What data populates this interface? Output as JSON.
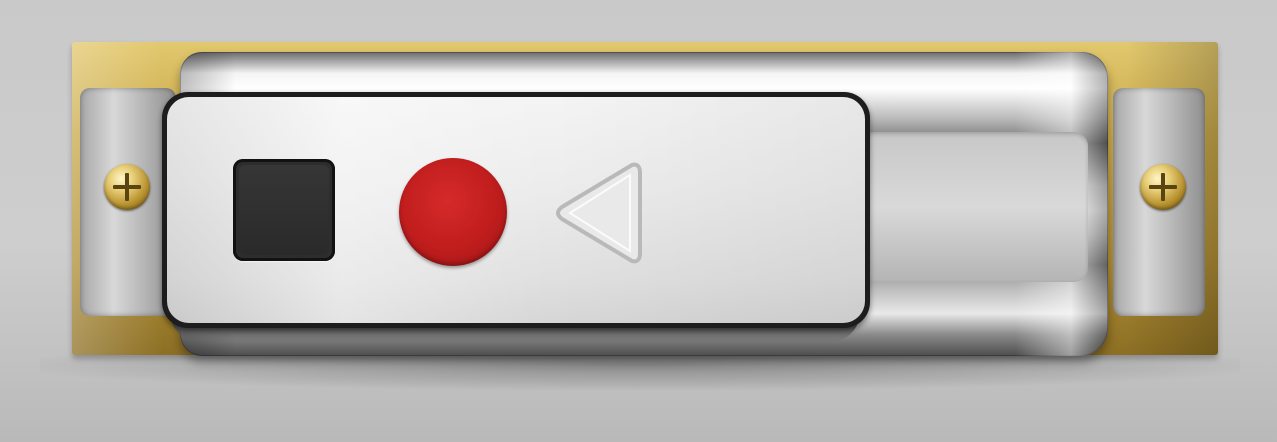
{
  "scene": {
    "subject": "",
    "colors": {
      "background": "#c9c9c9",
      "brass": "#c9a94b",
      "chrome": "#bdbdbd",
      "handle_face": "#ececec",
      "handle_border": "#1d1d1d",
      "red_button": "#c01d1d",
      "black_button": "#2d2d2d"
    }
  },
  "icons": {
    "square": "stop-square-icon",
    "circle": "record-circle-icon",
    "triangle": "play-back-triangle-icon",
    "screws": "phillips-screw-icon"
  }
}
